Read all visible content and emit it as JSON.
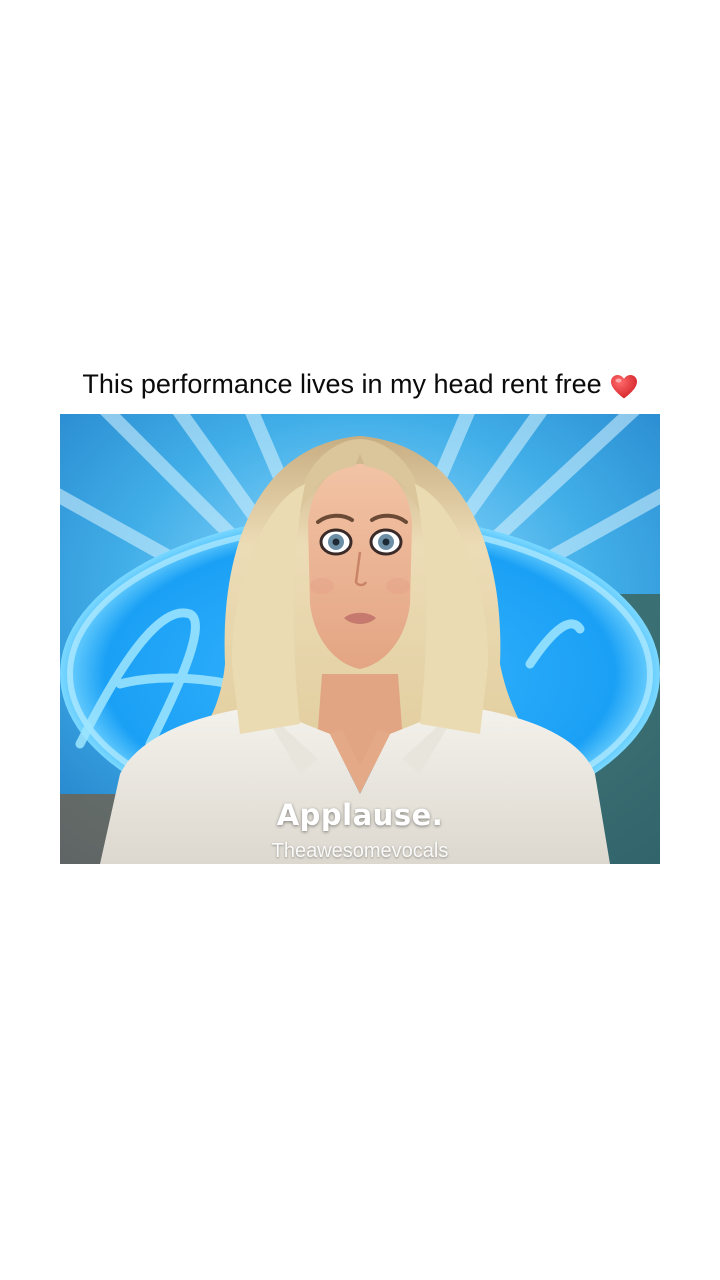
{
  "post": {
    "caption": "This performance lives in my head rent free",
    "caption_emoji": "heart-emoji",
    "accent_heart_color": "#e8242f"
  },
  "video": {
    "subtitle": "Applause.",
    "watermark": "Theawesomevocals"
  }
}
